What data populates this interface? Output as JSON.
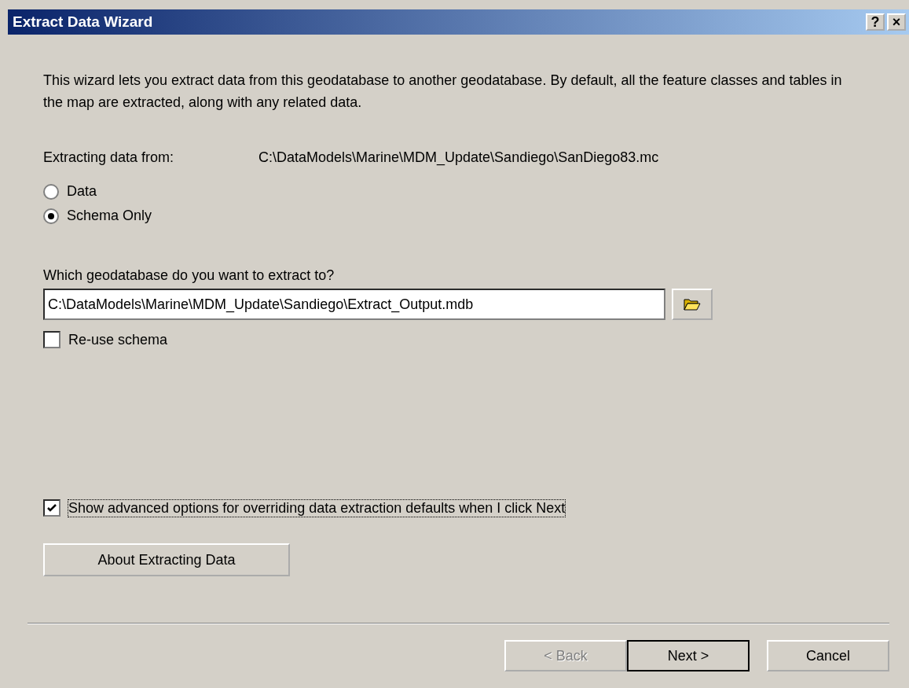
{
  "window": {
    "title": "Extract Data Wizard",
    "title_buttons": [
      "?",
      "×"
    ]
  },
  "intro": "This wizard lets you extract data from this geodatabase to another geodatabase. By default, all the feature classes and tables in the map are extracted, along with any related data.",
  "source": {
    "label": "Extracting data from:",
    "value": "C:\\DataModels\\Marine\\MDM_Update\\Sandiego\\SanDiego83.mc"
  },
  "mode_options": [
    {
      "label": "Data",
      "selected": false
    },
    {
      "label": "Schema Only",
      "selected": true
    }
  ],
  "target": {
    "label": "Which geodatabase do you want to extract to?",
    "value": "C:\\DataModels\\Marine\\MDM_Update\\Sandiego\\Extract_Output.mdb"
  },
  "reuse_schema": {
    "label": "Re-use schema",
    "checked": false
  },
  "advanced": {
    "label": "Show advanced options for overriding data extraction defaults when I click Next",
    "checked": true
  },
  "about_button": "About Extracting Data",
  "buttons": [
    {
      "label": "< Back",
      "disabled": true,
      "default": false
    },
    {
      "label": "Next >",
      "disabled": false,
      "default": true
    },
    {
      "label": "Cancel",
      "disabled": false,
      "default": false
    }
  ]
}
